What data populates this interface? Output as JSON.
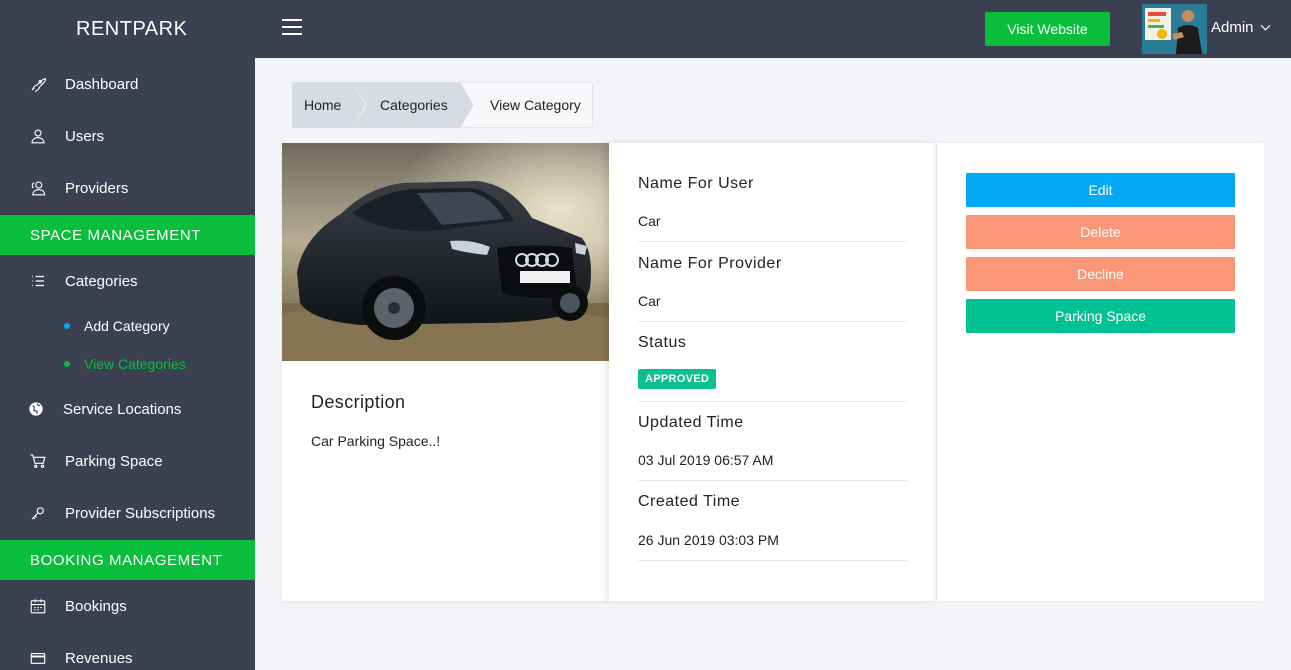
{
  "brand": "RENTPARK",
  "topbar": {
    "visit_label": "Visit Website",
    "admin_label": "Admin"
  },
  "sidebar": {
    "items": [
      {
        "label": "Dashboard",
        "icon": "rocket-icon"
      },
      {
        "label": "Users",
        "icon": "user-icon"
      },
      {
        "label": "Providers",
        "icon": "users-icon"
      }
    ],
    "space_section": "SPACE MANAGEMENT",
    "space_items": [
      {
        "label": "Categories",
        "icon": "list-icon"
      }
    ],
    "category_sub": [
      {
        "label": "Add Category"
      },
      {
        "label": "View Categories"
      }
    ],
    "space_items_after": [
      {
        "label": "Service Locations",
        "icon": "globe-icon"
      },
      {
        "label": "Parking Space",
        "icon": "cart-icon"
      },
      {
        "label": "Provider Subscriptions",
        "icon": "key-icon"
      }
    ],
    "booking_section": "BOOKING MANAGEMENT",
    "booking_items": [
      {
        "label": "Bookings",
        "icon": "calendar-icon"
      },
      {
        "label": "Revenues",
        "icon": "credit-card-icon"
      }
    ]
  },
  "breadcrumb": [
    "Home",
    "Categories",
    "View Category"
  ],
  "category": {
    "description_title": "Description",
    "description": "Car Parking Space..!",
    "fields": [
      {
        "label": "Name For User",
        "value": "Car"
      },
      {
        "label": "Name For Provider",
        "value": "Car"
      },
      {
        "label": "Status",
        "value": "APPROVED"
      },
      {
        "label": "Updated Time",
        "value": "03 Jul 2019 06:57 AM"
      },
      {
        "label": "Created Time",
        "value": "26 Jun 2019 03:03 PM"
      }
    ]
  },
  "actions": [
    {
      "label": "Edit",
      "color": "#03a9f4"
    },
    {
      "label": "Delete",
      "color": "#fb9678"
    },
    {
      "label": "Decline",
      "color": "#fb9678"
    },
    {
      "label": "Parking Space",
      "color": "#00c292"
    }
  ],
  "colors": {
    "sidebar_bg": "#3c4152",
    "accent_green": "#08be3a",
    "badge_approved": "#0bbf8e",
    "active_sub": "#08be3a",
    "dot_blue": "#03a9f4"
  }
}
